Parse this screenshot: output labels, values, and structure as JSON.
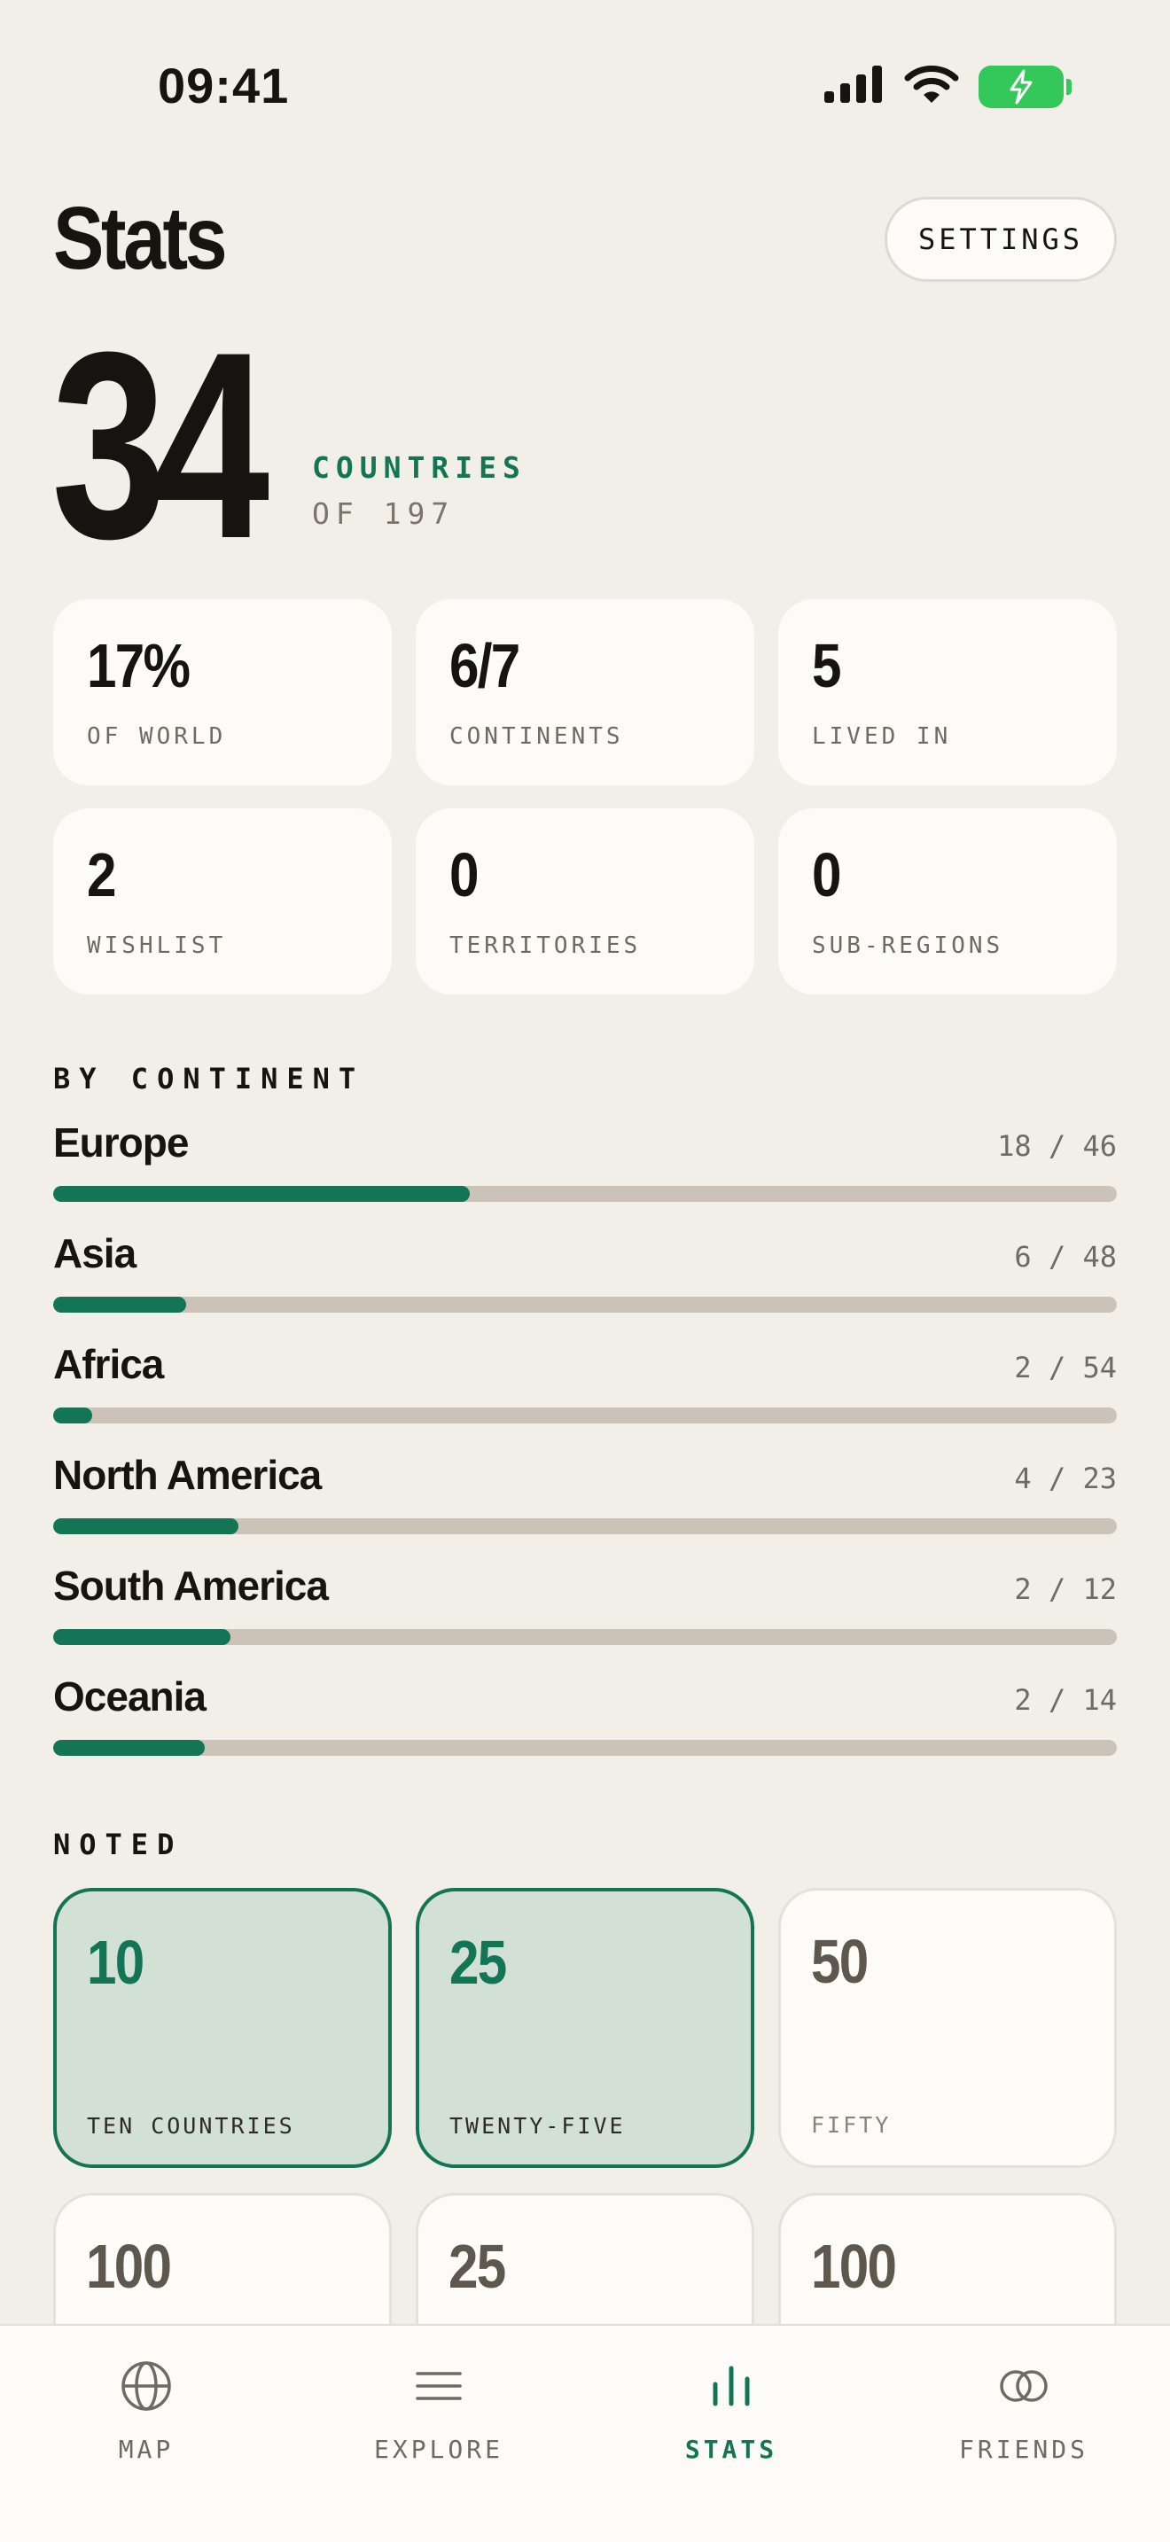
{
  "status_bar": {
    "time": "09:41"
  },
  "header": {
    "title": "Stats",
    "settings_label": "SETTINGS"
  },
  "summary": {
    "count": "34",
    "label": "COUNTRIES",
    "sub": "OF 197"
  },
  "stats": [
    {
      "value": "17%",
      "label": "OF WORLD"
    },
    {
      "value": "6/7",
      "label": "CONTINENTS"
    },
    {
      "value": "5",
      "label": "LIVED IN"
    },
    {
      "value": "2",
      "label": "WISHLIST"
    },
    {
      "value": "0",
      "label": "TERRITORIES"
    },
    {
      "value": "0",
      "label": "SUB-REGIONS"
    }
  ],
  "by_continent": {
    "title": "BY CONTINENT",
    "items": [
      {
        "name": "Europe",
        "count": "18 / 46",
        "visited": 18,
        "total": 46
      },
      {
        "name": "Asia",
        "count": "6 / 48",
        "visited": 6,
        "total": 48
      },
      {
        "name": "Africa",
        "count": "2 / 54",
        "visited": 2,
        "total": 54
      },
      {
        "name": "North America",
        "count": "4 / 23",
        "visited": 4,
        "total": 23
      },
      {
        "name": "South America",
        "count": "2 / 12",
        "visited": 2,
        "total": 12
      },
      {
        "name": "Oceania",
        "count": "2 / 14",
        "visited": 2,
        "total": 14
      }
    ]
  },
  "noted": {
    "title": "NOTED",
    "items": [
      {
        "value": "10",
        "label": "TEN COUNTRIES",
        "earned": true
      },
      {
        "value": "25",
        "label": "TWENTY-FIVE",
        "earned": true
      },
      {
        "value": "50",
        "label": "FIFTY",
        "earned": false
      },
      {
        "value": "100",
        "label": "",
        "earned": false
      },
      {
        "value": "25",
        "label": "",
        "earned": false
      },
      {
        "value": "100",
        "label": "",
        "earned": false
      }
    ]
  },
  "tabs": [
    {
      "label": "MAP",
      "icon": "globe-icon",
      "active": false
    },
    {
      "label": "EXPLORE",
      "icon": "list-icon",
      "active": false
    },
    {
      "label": "STATS",
      "icon": "bar-chart-icon",
      "active": true
    },
    {
      "label": "FRIENDS",
      "icon": "overlap-circles-icon",
      "active": false
    }
  ],
  "colors": {
    "accent": "#137456",
    "background": "#f2eee8",
    "card": "#fcfbf8",
    "track": "#cbc3b7",
    "battery": "#34c759"
  }
}
